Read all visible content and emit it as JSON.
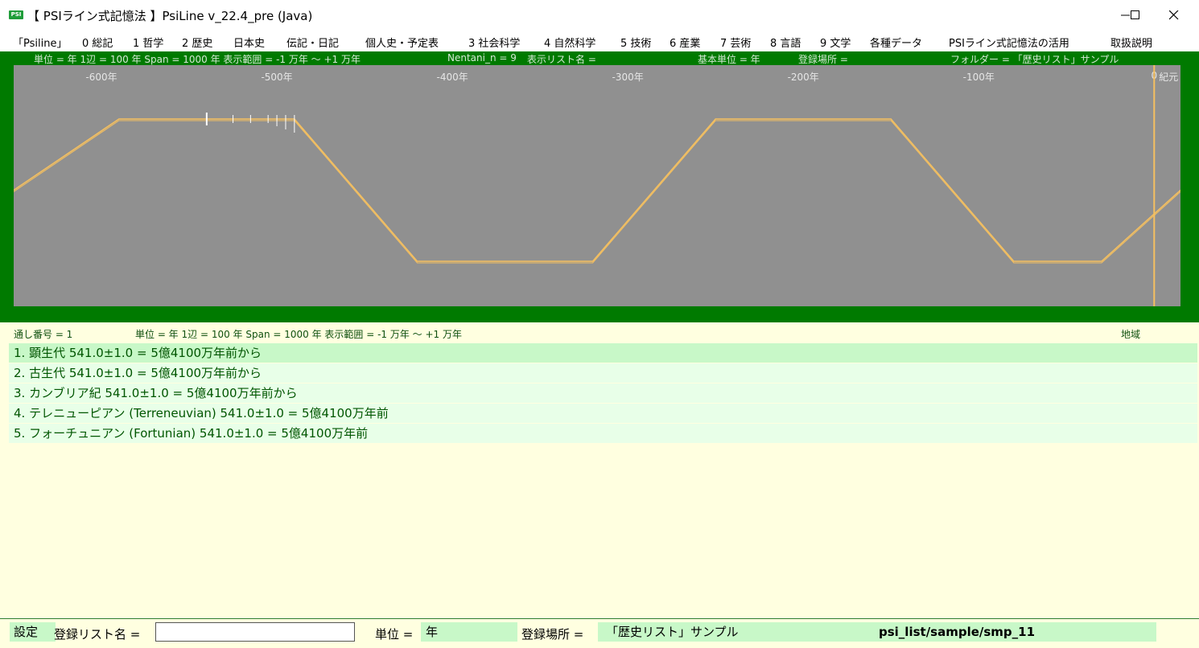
{
  "window": {
    "title": "【 PSIライン式記憶法 】PsiLine v_22.4_pre (Java)",
    "icon_text": "PSI"
  },
  "menu": [
    "「Psiline」",
    "0 総記",
    "1 哲学",
    "2 歴史",
    "日本史",
    "伝記・日記",
    "個人史・予定表",
    "3 社会科学",
    "4 自然科学",
    "5 技術",
    "6 産業",
    "7 芸術",
    "8 言語",
    "9 文学",
    "各種データ",
    "PSIライン式記憶法の活用",
    "取扱説明"
  ],
  "info_bar": {
    "unit": "単位 = 年  1辺 = 100 年  Span = 1000 年  表示範囲 = -1 万年 〜 +1 万年",
    "nentani": "Nentani_n = 9",
    "list_name": "表示リスト名 =",
    "base_unit": "基本単位 = 年",
    "location": "登録場所 =",
    "folder": "フォルダー = 「歴史リスト」サンプル"
  },
  "chart_data": {
    "type": "line",
    "x_tick_labels": [
      "-600年",
      "-500年",
      "-400年",
      "-300年",
      "-200年",
      "-100年",
      "0",
      "紀元"
    ],
    "x_ticks": [
      -600,
      -500,
      -400,
      -300,
      -200,
      -100,
      0
    ],
    "xlim": [
      -650,
      15
    ],
    "series": [
      {
        "x": [
          -650,
          -590,
          -490,
          -420,
          -320,
          -250,
          -150,
          -80,
          -30,
          15
        ],
        "y": [
          0.5,
          1,
          1,
          0,
          0,
          1,
          1,
          0,
          0,
          0.5
        ]
      }
    ],
    "markers_x": [
      -540,
      -525,
      -515,
      -505,
      -500,
      -495,
      -490
    ],
    "current_line_x": 0
  },
  "content_header": {
    "serial": "通し番号 = 1",
    "unit": "単位 = 年  1辺 = 100 年  Span = 1000 年  表示範囲 = -1 万年 〜 +1 万年",
    "region": "地域"
  },
  "list_items": [
    "1. 顕生代 541.0±1.0 = 5億4100万年前から",
    "2. 古生代 541.0±1.0 = 5億4100万年前から",
    "3. カンブリア紀 541.0±1.0 = 5億4100万年前から",
    "4. テレニューピアン (Terreneuvian) 541.0±1.0 = 5億4100万年前",
    "5. フォーチュニアン (Fortunian) 541.0±1.0 = 5億4100万年前"
  ],
  "bottom_bar": {
    "settings": "設定",
    "list_name_label": "登録リスト名 =",
    "list_name_value": "",
    "unit_label": "単位 =",
    "unit_value": "年",
    "location_label": "登録場所 =",
    "location_value": "「歴史リスト」サンプル",
    "path": "psi_list/sample/smp_11"
  },
  "colors": {
    "panel_green": "#007a00",
    "chart_gray": "#909090",
    "line": "#f5c060",
    "content_bg": "#ffffe0",
    "row_bg": "#e8ffe8",
    "row_selected": "#c8f8c8"
  }
}
